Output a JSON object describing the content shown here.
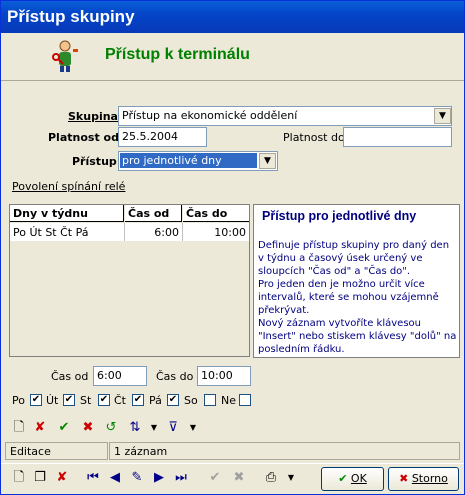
{
  "window": {
    "title": "Přístup skupiny"
  },
  "header": {
    "title": "Přístup k terminálu",
    "icon": "user-key-icon"
  },
  "form": {
    "group_label": "Skupina",
    "group_value": "Přístup na ekonomické oddělení",
    "valid_from_label": "Platnost od",
    "valid_from_value": "25.5.2004",
    "valid_to_label": "Platnost do",
    "valid_to_value": "",
    "access_label": "Přístup",
    "access_value": "pro jednotlivé dny"
  },
  "link": {
    "label": "Povolení spínání relé"
  },
  "grid": {
    "columns": [
      "Dny v týdnu",
      "Čas od",
      "Čas do"
    ],
    "rows": [
      [
        "Po Út St Čt Pá",
        "6:00",
        "10:00"
      ]
    ]
  },
  "info": {
    "title": "Přístup pro jednotlivé dny",
    "text": "Definuje přístup skupiny pro daný den v týdnu a časový úsek určený ve sloupcích \"Čas od\" a \"Čas do\".\nPro jeden den je možno určit více intervalů, které se mohou vzájemně překrývat.\nNový záznam vytvoříte klávesou \"Insert\" nebo stiskem klávesy \"dolů\" na posledním řádku."
  },
  "time": {
    "from_label": "Čas od",
    "from_value": "6:00",
    "to_label": "Čas do",
    "to_value": "10:00"
  },
  "days": [
    {
      "label": "Po",
      "checked": true
    },
    {
      "label": "Út",
      "checked": true
    },
    {
      "label": "St",
      "checked": true
    },
    {
      "label": "Čt",
      "checked": true
    },
    {
      "label": "Pá",
      "checked": true
    },
    {
      "label": "So",
      "checked": false
    },
    {
      "label": "Ne",
      "checked": false
    }
  ],
  "status": {
    "mode": "Editace",
    "records": "1 záznam"
  },
  "buttons": {
    "ok_label": "OK",
    "cancel_label": "Storno"
  },
  "colors": {
    "title_bar": "#0a5fd8",
    "header_green": "#008000",
    "info_text": "#000080",
    "selection": "#316ac5"
  }
}
